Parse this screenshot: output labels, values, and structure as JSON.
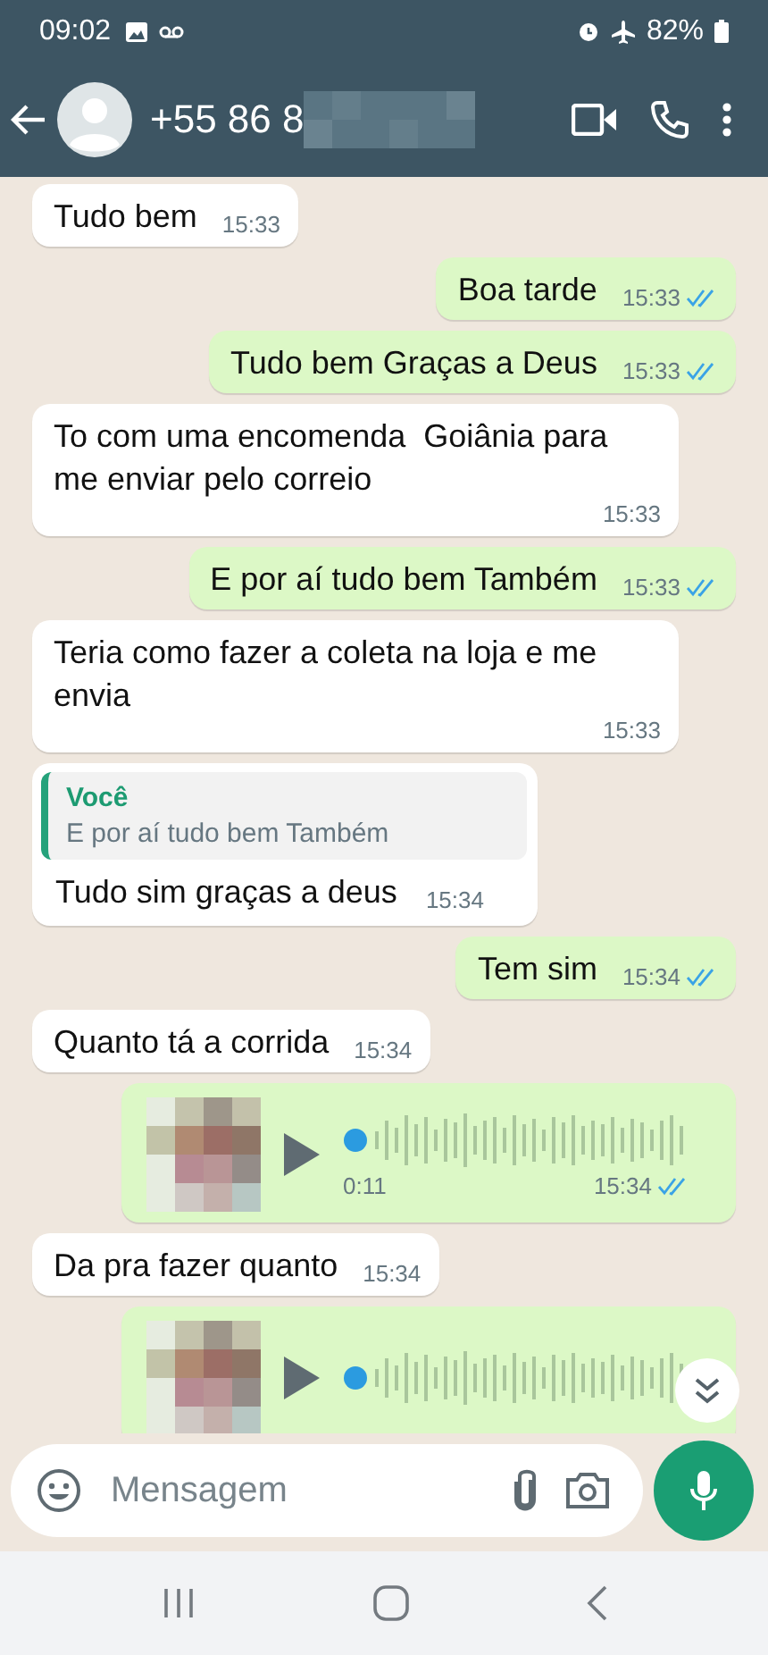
{
  "status_bar": {
    "time": "09:02",
    "battery": "82%"
  },
  "header": {
    "contact": "+55 86 8"
  },
  "messages": [
    {
      "kind": "text",
      "outgoing": false,
      "text": "Tudo bem",
      "time": "15:33"
    },
    {
      "kind": "text",
      "outgoing": true,
      "read": true,
      "text": "Boa tarde",
      "time": "15:33"
    },
    {
      "kind": "text",
      "outgoing": true,
      "read": true,
      "text": "Tudo bem Graças a Deus",
      "time": "15:33"
    },
    {
      "kind": "text",
      "outgoing": false,
      "text": "To com uma encomenda  Goiânia para me enviar pelo correio",
      "time": "15:33"
    },
    {
      "kind": "text",
      "outgoing": true,
      "read": true,
      "text": "E por aí tudo bem Também",
      "time": "15:33"
    },
    {
      "kind": "text",
      "outgoing": false,
      "text": "Teria como fazer a coleta na loja e me envia",
      "time": "15:33"
    },
    {
      "kind": "reply",
      "outgoing": false,
      "quote_author": "Você",
      "quote_text": "E por aí tudo bem Também",
      "text": "Tudo sim graças a deus",
      "time": "15:34"
    },
    {
      "kind": "text",
      "outgoing": true,
      "read": true,
      "text": "Tem sim",
      "time": "15:34"
    },
    {
      "kind": "text",
      "outgoing": false,
      "text": "Quanto tá a corrida",
      "time": "15:34"
    },
    {
      "kind": "voice",
      "outgoing": true,
      "read": true,
      "duration": "0:11",
      "time": "15:34"
    },
    {
      "kind": "text",
      "outgoing": false,
      "text": "Da pra fazer quanto",
      "time": "15:34"
    },
    {
      "kind": "voice",
      "outgoing": true
    }
  ],
  "composer": {
    "placeholder": "Mensagem"
  }
}
